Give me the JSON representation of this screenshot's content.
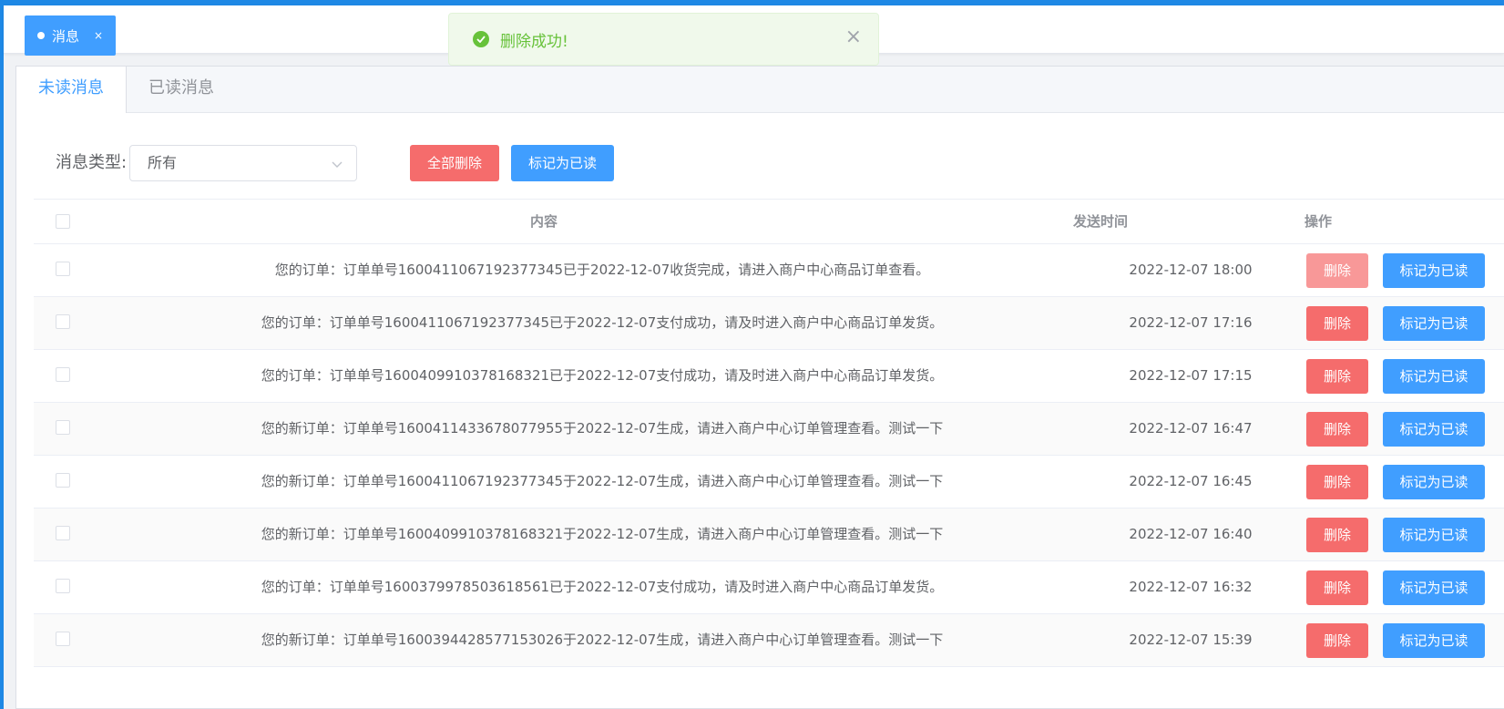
{
  "tag": {
    "label": "消息",
    "close": "×"
  },
  "toast": {
    "message": "删除成功!",
    "close": "×"
  },
  "tabs": [
    {
      "label": "未读消息",
      "active": true
    },
    {
      "label": "已读消息",
      "active": false
    }
  ],
  "filter": {
    "label": "消息类型:",
    "selected": "所有",
    "delete_all_label": "全部删除",
    "mark_all_label": "标记为已读"
  },
  "table": {
    "headers": {
      "content": "内容",
      "time": "发送时间",
      "actions": "操作"
    },
    "delete_label": "删除",
    "mark_label": "标记为已读",
    "rows": [
      {
        "content": "您的订单：订单单号1600411067192377345已于2022-12-07收货完成，请进入商户中心商品订单查看。",
        "time": "2022-12-07 18:00"
      },
      {
        "content": "您的订单：订单单号1600411067192377345已于2022-12-07支付成功，请及时进入商户中心商品订单发货。",
        "time": "2022-12-07 17:16"
      },
      {
        "content": "您的订单：订单单号1600409910378168321已于2022-12-07支付成功，请及时进入商户中心商品订单发货。",
        "time": "2022-12-07 17:15"
      },
      {
        "content": "您的新订单：订单单号1600411433678077955于2022-12-07生成，请进入商户中心订单管理查看。测试一下",
        "time": "2022-12-07 16:47"
      },
      {
        "content": "您的新订单：订单单号1600411067192377345于2022-12-07生成，请进入商户中心订单管理查看。测试一下",
        "time": "2022-12-07 16:45"
      },
      {
        "content": "您的新订单：订单单号1600409910378168321于2022-12-07生成，请进入商户中心订单管理查看。测试一下",
        "time": "2022-12-07 16:40"
      },
      {
        "content": "您的订单：订单单号1600379978503618561已于2022-12-07支付成功，请及时进入商户中心商品订单发货。",
        "time": "2022-12-07 16:32"
      },
      {
        "content": "您的新订单：订单单号1600394428577153026于2022-12-07生成，请进入商户中心订单管理查看。测试一下",
        "time": "2022-12-07 15:39"
      }
    ]
  },
  "colors": {
    "primary": "#409eff",
    "danger": "#f56c6c",
    "success": "#67c23a"
  }
}
